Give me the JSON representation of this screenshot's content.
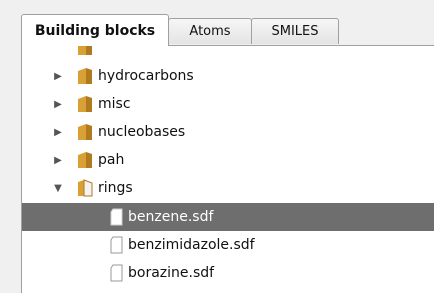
{
  "tabs": [
    {
      "label": "Building blocks",
      "active": true
    },
    {
      "label": "Atoms",
      "active": false
    },
    {
      "label": "SMILES",
      "active": false
    }
  ],
  "tree": {
    "folders": [
      {
        "label": "hydrocarbons",
        "expanded": false
      },
      {
        "label": "misc",
        "expanded": false
      },
      {
        "label": "nucleobases",
        "expanded": false
      },
      {
        "label": "pah",
        "expanded": false
      },
      {
        "label": "rings",
        "expanded": true
      }
    ],
    "files": [
      {
        "label": "benzene.sdf",
        "selected": true
      },
      {
        "label": "benzimidazole.sdf",
        "selected": false
      },
      {
        "label": "borazine.sdf",
        "selected": false
      }
    ]
  },
  "colors": {
    "selection": "#6e6e6e",
    "folder": "#d9a036",
    "tab_border": "#a0a0a0"
  }
}
